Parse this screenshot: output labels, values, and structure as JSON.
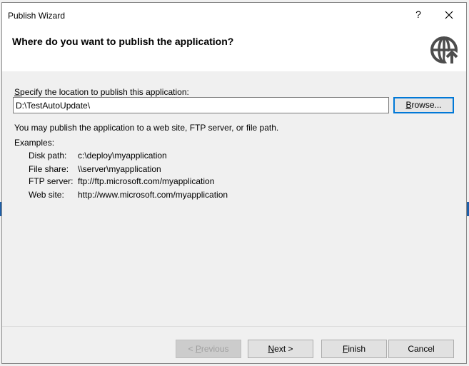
{
  "window": {
    "title": "Publish Wizard",
    "help_label": "?"
  },
  "header": {
    "title": "Where do you want to publish the application?",
    "icon": "globe-publish-icon"
  },
  "location": {
    "prompt_prefix": "S",
    "prompt_rest": "pecify the location to publish this application:",
    "value": "D:\\TestAutoUpdate\\",
    "browse_prefix": "B",
    "browse_rest": "rowse..."
  },
  "info": "You may publish the application to a web site, FTP server, or file path.",
  "examples": {
    "label": "Examples:",
    "rows": [
      {
        "key": "Disk path:",
        "value": "c:\\deploy\\myapplication"
      },
      {
        "key": "File share:",
        "value": "\\\\server\\myapplication"
      },
      {
        "key": "FTP server:",
        "value": "ftp://ftp.microsoft.com/myapplication"
      },
      {
        "key": "Web site:",
        "value": "http://www.microsoft.com/myapplication"
      }
    ]
  },
  "buttons": {
    "previous_prefix": "< ",
    "previous_key": "P",
    "previous_rest": "revious",
    "next_key": "N",
    "next_rest": "ext >",
    "finish_key": "F",
    "finish_rest": "inish",
    "cancel": "Cancel"
  },
  "colors": {
    "accent": "#0078d7",
    "icon": "#4d4d4d"
  }
}
